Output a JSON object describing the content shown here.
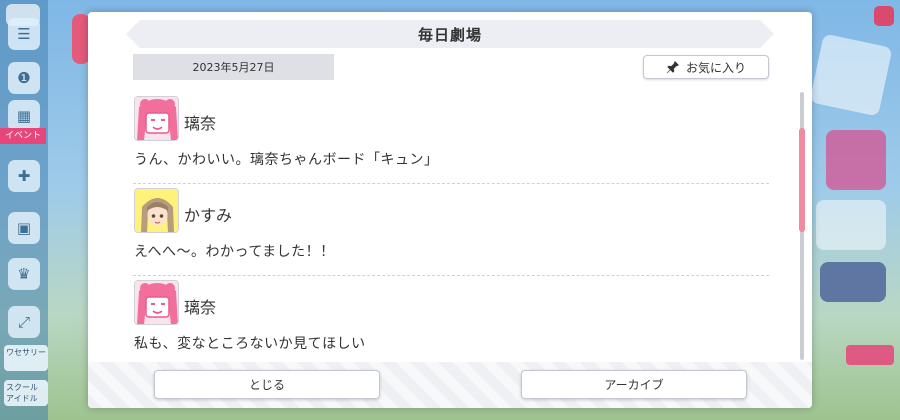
{
  "dialog": {
    "title": "毎日劇場",
    "date": "2023年5月27日",
    "favorite_label": "お気に入り",
    "favorite_icon": "pin-icon",
    "messages": [
      {
        "speaker": "璃奈",
        "avatar": "rina-avatar",
        "text": "うん、かわいい。璃奈ちゃんボード「キュン」"
      },
      {
        "speaker": "かすみ",
        "avatar": "kasumi-avatar",
        "text": "えへへ〜。わかってました！！"
      },
      {
        "speaker": "璃奈",
        "avatar": "rina-avatar",
        "text": "私も、変なところないか見てほしい"
      }
    ],
    "close_label": "とじる",
    "archive_label": "アーカイブ"
  },
  "background": {
    "event_badge": "イベント",
    "sidebar_labels": [
      "ワセサリー",
      "スクール アイドル"
    ]
  },
  "colors": {
    "accent_pink": "#f08aa0",
    "title_bar": "#eceef3",
    "date_box": "#dfe0e6"
  }
}
